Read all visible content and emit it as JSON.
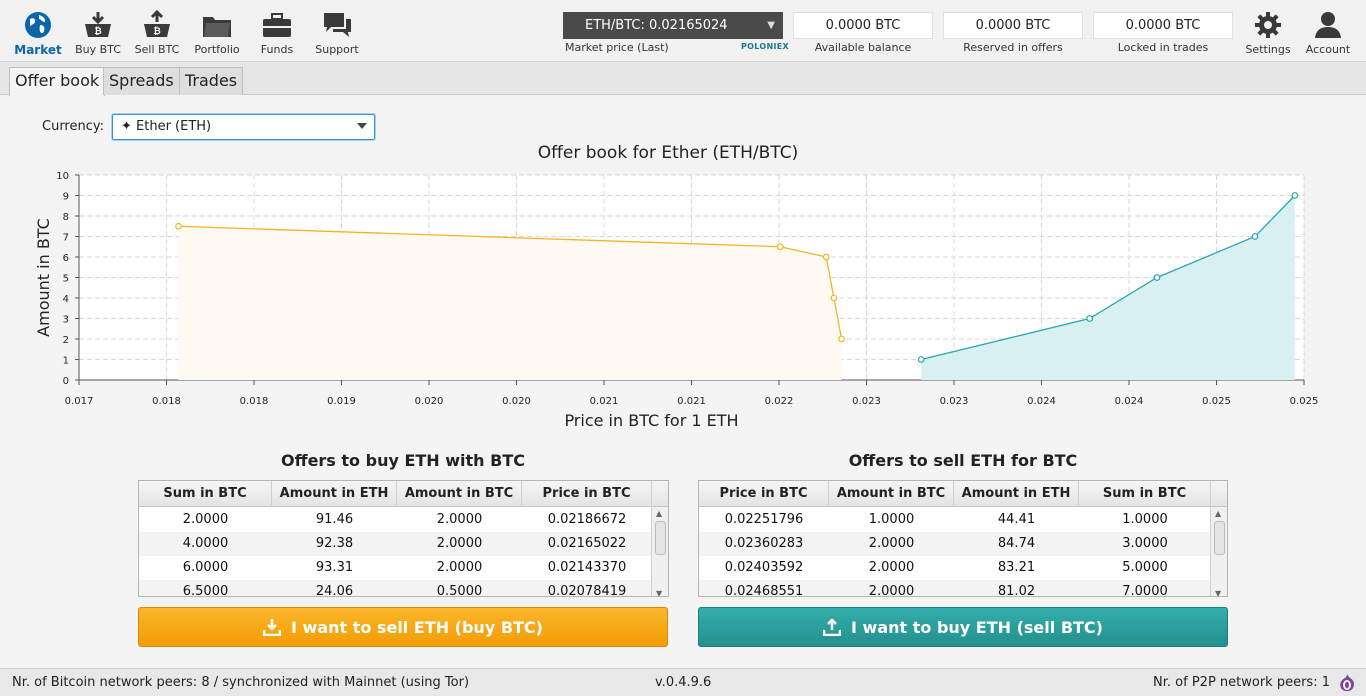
{
  "nav": {
    "items": [
      {
        "label": "Market",
        "icon": "globe-icon",
        "active": true
      },
      {
        "label": "Buy BTC",
        "icon": "buy-btc-icon"
      },
      {
        "label": "Sell BTC",
        "icon": "sell-btc-icon"
      },
      {
        "label": "Portfolio",
        "icon": "folder-icon"
      },
      {
        "label": "Funds",
        "icon": "briefcase-icon"
      },
      {
        "label": "Support",
        "icon": "chat-icon"
      }
    ],
    "settings_label": "Settings",
    "account_label": "Account"
  },
  "market": {
    "selected": "ETH/BTC: 0.02165024",
    "price_label": "Market price (Last)",
    "provider": "POLONIEX"
  },
  "balances": {
    "available": {
      "value": "0.0000 BTC",
      "label": "Available balance"
    },
    "reserved": {
      "value": "0.0000 BTC",
      "label": "Reserved in offers"
    },
    "locked": {
      "value": "0.0000 BTC",
      "label": "Locked in trades"
    }
  },
  "tabs": [
    "Offer book",
    "Spreads",
    "Trades"
  ],
  "currency": {
    "label": "Currency:",
    "selected": "✦ Ether (ETH)"
  },
  "chart_data": {
    "type": "area",
    "title": "Offer book for Ether (ETH/BTC)",
    "xlabel": "Price in BTC for 1 ETH",
    "ylabel": "Amount in BTC",
    "xlim": [
      0.017,
      0.025
    ],
    "ylim": [
      0,
      10
    ],
    "x_tick_labels": [
      "0.017",
      "0.018",
      "0.018",
      "0.019",
      "0.020",
      "0.020",
      "0.021",
      "0.021",
      "0.022",
      "0.023",
      "0.023",
      "0.024",
      "0.024",
      "0.025",
      "0.025"
    ],
    "y_ticks": [
      0,
      1,
      2,
      3,
      4,
      5,
      6,
      7,
      8,
      9,
      10
    ],
    "grid": true,
    "series": [
      {
        "side": "buy",
        "color": "#f0b429",
        "fill": "#fef9f1",
        "points": [
          [
            0.01765,
            7.5
          ],
          [
            0.02158,
            6.5
          ],
          [
            0.02188,
            6.0
          ],
          [
            0.02193,
            4.0
          ],
          [
            0.02198,
            2.0
          ]
        ]
      },
      {
        "side": "sell",
        "color": "#2aa7b0",
        "fill": "#d8f0f2",
        "points": [
          [
            0.0225,
            1.0
          ],
          [
            0.0236,
            3.0
          ],
          [
            0.02404,
            5.0
          ],
          [
            0.02468,
            7.0
          ],
          [
            0.02494,
            9.0
          ]
        ]
      }
    ]
  },
  "buy_offers": {
    "title": "Offers to buy ETH with BTC",
    "columns": [
      "Sum in BTC",
      "Amount in ETH",
      "Amount in BTC",
      "Price in BTC"
    ],
    "rows": [
      [
        "2.0000",
        "91.46",
        "2.0000",
        "0.02186672"
      ],
      [
        "4.0000",
        "92.38",
        "2.0000",
        "0.02165022"
      ],
      [
        "6.0000",
        "93.31",
        "2.0000",
        "0.02143370"
      ],
      [
        "6.5000",
        "24.06",
        "0.5000",
        "0.02078419"
      ]
    ],
    "action_label": "I want to sell ETH (buy BTC)"
  },
  "sell_offers": {
    "title": "Offers to sell ETH for BTC",
    "columns": [
      "Price in BTC",
      "Amount in BTC",
      "Amount in ETH",
      "Sum in BTC"
    ],
    "rows": [
      [
        "0.02251796",
        "1.0000",
        "44.41",
        "1.0000"
      ],
      [
        "0.02360283",
        "2.0000",
        "84.74",
        "3.0000"
      ],
      [
        "0.02403592",
        "2.0000",
        "83.21",
        "5.0000"
      ],
      [
        "0.02468551",
        "2.0000",
        "81.02",
        "7.0000"
      ]
    ],
    "action_label": "I want to buy ETH (sell BTC)"
  },
  "footer": {
    "bitcoin_status": "Nr. of Bitcoin network peers: 8 / synchronized with Mainnet (using Tor)",
    "version": "v.0.4.9.6",
    "p2p_status": "Nr. of P2P network peers: 1"
  }
}
